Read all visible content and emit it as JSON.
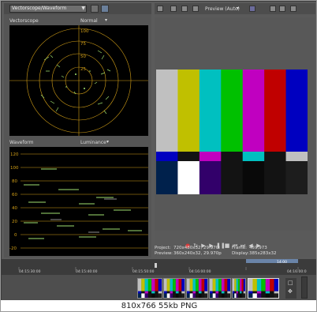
{
  "scope": {
    "mode_select": "Vectorscope/Waveform",
    "vectorscope_label": "Vectorscope",
    "vectorscope_mode": "Normal",
    "vectorscope_scale": [
      "100",
      "75",
      "50",
      "25"
    ],
    "waveform_label": "Waveform",
    "waveform_mode": "Luminance",
    "waveform_scale": [
      "120",
      "100",
      "80",
      "60",
      "40",
      "20",
      "0",
      "-20"
    ]
  },
  "preview": {
    "quality": "Preview (Auto)",
    "project_label": "Project:",
    "project_value": "720x480x32, 29.970i",
    "preview_label": "Preview:",
    "preview_value": "360x240x32, 29.970p",
    "frame_label": "Frame:",
    "frame_value": "459,973",
    "display_label": "Display:",
    "display_value": "385x283x32"
  },
  "timeline": {
    "ticks": [
      "04:15:30:00",
      "04:15:40:00",
      "04:15:50:00",
      "04:16:00:00"
    ],
    "end_tick": "04:16:00:0"
  },
  "status_text": "810x766  55kb  PNG",
  "colors": {
    "bars_top": [
      "#c0c0c0",
      "#c0c000",
      "#00c0c0",
      "#00c000",
      "#c000c0",
      "#c00000",
      "#0000c0"
    ],
    "bars_mid": [
      "#0000c0",
      "#131313",
      "#c000c0",
      "#131313",
      "#00c0c0",
      "#131313",
      "#c0c0c0"
    ],
    "bars_bottom": [
      "#00214c",
      "#ffffff",
      "#32006a",
      "#131313",
      "#090909",
      "#131313",
      "#1d1d1d"
    ],
    "scope_grid": "#d4a017",
    "scope_trace": "#9fe06f"
  }
}
